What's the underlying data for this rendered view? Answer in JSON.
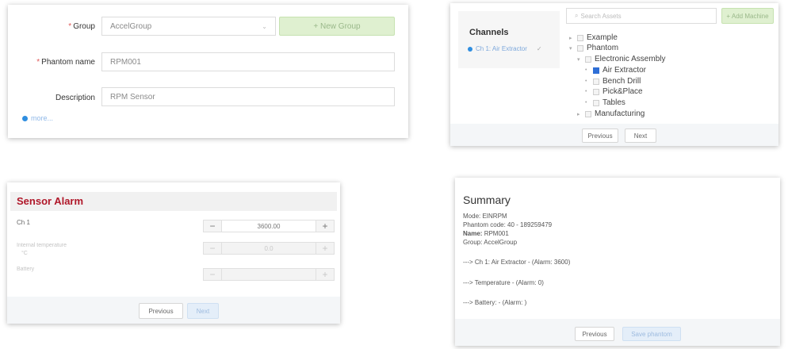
{
  "group_form": {
    "group_label": "Group",
    "group_value": "AccelGroup",
    "new_group_label": "+ New Group",
    "phantom_name_label": "Phantom name",
    "phantom_name_value": "RPM001",
    "description_label": "Description",
    "description_value": "RPM Sensor",
    "more_label": "more..."
  },
  "channels": {
    "title": "Channels",
    "channel_item": "Ch 1: Air Extractor",
    "search_placeholder": "Search Assets",
    "add_machine_label": "+ Add Machine",
    "tree": [
      "Example",
      "Phantom",
      "Electronic Assembly",
      "Air Extractor",
      "Bench Drill",
      "Pick&Place",
      "Tables",
      "Manufacturing"
    ],
    "previous_label": "Previous",
    "next_label": "Next"
  },
  "sensor_alarm": {
    "title": "Sensor Alarm",
    "ch1_label": "Ch 1",
    "ch1_value": "3600.00",
    "temp_label": "Internal temperature",
    "temp_unit": "°C",
    "temp_value": "0.0",
    "battery_label": "Battery",
    "previous_label": "Previous",
    "next_label": "Next",
    "minus": "−",
    "plus": "+"
  },
  "summary": {
    "title": "Summary",
    "mode": "Mode: EINRPM",
    "phantom_code": "Phantom code: 40 - 189259479",
    "name_key": "Name:",
    "name_value": "RPM001",
    "group": "Group: AccelGroup",
    "line_ch1": "---> Ch 1: Air Extractor - (Alarm: 3600)",
    "line_temp": "---> Temperature - (Alarm: 0)",
    "line_battery": "---> Battery: - (Alarm: )",
    "previous_label": "Previous",
    "save_label": "Save phantom"
  },
  "colors": {
    "accent_blue": "#2f8ee0",
    "alarm_red": "#b0182a",
    "green_button": "#dff0d0"
  }
}
